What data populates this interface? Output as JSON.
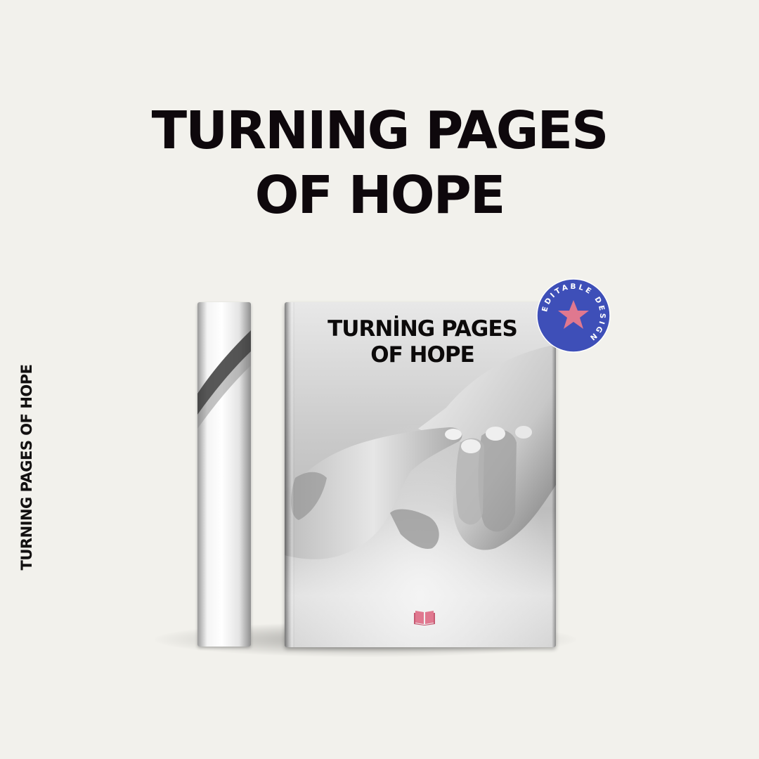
{
  "headline": {
    "line1": "TURNING PAGES",
    "line2": "OF HOPE"
  },
  "book": {
    "spine_title": "TURNING PAGES OF HOPE",
    "cover_title_line1": "TURNİNG PAGES",
    "cover_title_line2": "OF HOPE",
    "publisher_logo_icon": "open-book-icon",
    "logo_color": "#e0788f"
  },
  "badge": {
    "text": "EDITABLE DESIGN",
    "icon": "star-icon",
    "background_color": "#3e4fb8",
    "star_color": "#e0788f"
  },
  "colors": {
    "background": "#f2f1ec",
    "text": "#0e080c"
  }
}
